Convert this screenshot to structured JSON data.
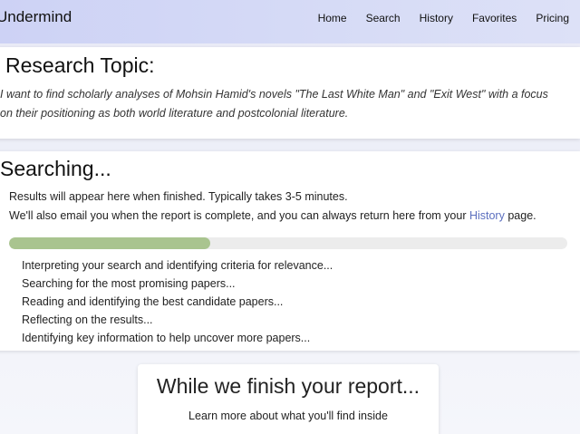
{
  "nav": {
    "brand": "Undermind",
    "links": [
      "Home",
      "Search",
      "History",
      "Favorites",
      "Pricing"
    ]
  },
  "topic": {
    "heading": "Research Topic:",
    "line1": "I want to find scholarly analyses of Mohsin Hamid's novels \"The Last White Man\" and \"Exit West\" with a focus",
    "line2": "on their positioning as both world literature and postcolonial literature."
  },
  "search": {
    "heading": "Searching...",
    "line1": "Results will appear here when finished. Typically takes 3-5 minutes.",
    "line2_before": "We'll also email you when the report is complete, and you can always return here from your ",
    "line2_link": "History",
    "line2_after": " page.",
    "progress_percent": 36,
    "progress_color": "#a9c48f",
    "steps": [
      "Interpreting your search and identifying criteria for relevance...",
      "Searching for the most promising papers...",
      "Reading and identifying the best candidate papers...",
      "Reflecting on the results...",
      "Identifying key information to help uncover more papers..."
    ]
  },
  "finish": {
    "heading": "While we finish your report...",
    "subtext": "Learn more about what you'll find inside"
  }
}
